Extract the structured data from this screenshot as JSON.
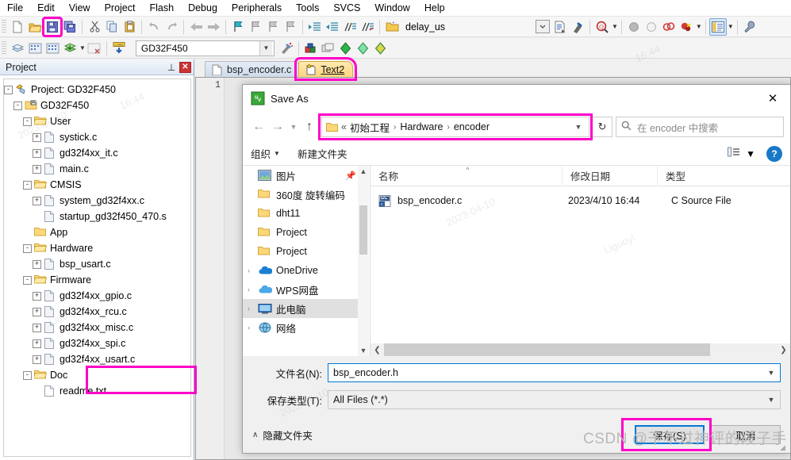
{
  "app": {
    "menu": [
      "File",
      "Edit",
      "View",
      "Project",
      "Flash",
      "Debug",
      "Peripherals",
      "Tools",
      "SVCS",
      "Window",
      "Help"
    ],
    "toolbar1": {
      "icons": [
        "new-file-icon",
        "open-folder-icon",
        "save-icon",
        "save-all-icon",
        "cut-icon",
        "copy-icon",
        "paste-icon",
        "undo-icon",
        "redo-icon",
        "navigate-back-icon",
        "navigate-forward-icon",
        "bookmark-toggle-icon",
        "bookmark-prev-icon",
        "bookmark-next-icon",
        "bookmark-clear-icon",
        "indent-right-icon",
        "indent-left-icon",
        "comment-icon",
        "uncomment-icon"
      ],
      "function_value": "delay_us",
      "right_icons": [
        "combo-dropdown-icon",
        "insert-file-icon",
        "debug-icon",
        "find-in-files-icon",
        "build-stop-icon",
        "build-run-icon",
        "breakpoint-icon",
        "breakpoint-disable-icon",
        "window-layout-icon",
        "configure-icon"
      ]
    },
    "toolbar2": {
      "target_value": "GD32F450",
      "icons": [
        "translate-icon",
        "build-icon",
        "rebuild-icon",
        "batch-build-icon",
        "stop-build-icon",
        "download-icon",
        "target-options-icon",
        "manage-components-icon",
        "pack-installer-icon",
        "configuration-wizard-icon",
        "books-icon"
      ]
    },
    "highlight_color": "#ff00c8"
  },
  "project_panel": {
    "title": "Project",
    "pin_icon": "pin-icon",
    "close_icon": "close-icon",
    "tree": [
      {
        "label": "Project: GD32F450",
        "depth": 0,
        "expander": "-",
        "icon": "project-icon"
      },
      {
        "label": "GD32F450",
        "depth": 1,
        "expander": "-",
        "icon": "target-icon"
      },
      {
        "label": "User",
        "depth": 2,
        "expander": "-",
        "icon": "folder-open-icon"
      },
      {
        "label": "systick.c",
        "depth": 3,
        "expander": "+",
        "icon": "c-file-icon"
      },
      {
        "label": "gd32f4xx_it.c",
        "depth": 3,
        "expander": "+",
        "icon": "c-file-icon"
      },
      {
        "label": "main.c",
        "depth": 3,
        "expander": "+",
        "icon": "c-file-icon"
      },
      {
        "label": "CMSIS",
        "depth": 2,
        "expander": "-",
        "icon": "folder-open-icon"
      },
      {
        "label": "system_gd32f4xx.c",
        "depth": 3,
        "expander": "+",
        "icon": "c-file-icon"
      },
      {
        "label": "startup_gd32f450_470.s",
        "depth": 3,
        "expander": "",
        "icon": "asm-file-icon"
      },
      {
        "label": "App",
        "depth": 2,
        "expander": "",
        "icon": "folder-icon"
      },
      {
        "label": "Hardware",
        "depth": 2,
        "expander": "-",
        "icon": "folder-open-icon"
      },
      {
        "label": "bsp_usart.c",
        "depth": 3,
        "expander": "+",
        "icon": "c-file-icon"
      },
      {
        "label": "Firmware",
        "depth": 2,
        "expander": "-",
        "icon": "folder-open-icon"
      },
      {
        "label": "gd32f4xx_gpio.c",
        "depth": 3,
        "expander": "+",
        "icon": "c-file-icon"
      },
      {
        "label": "gd32f4xx_rcu.c",
        "depth": 3,
        "expander": "+",
        "icon": "c-file-icon"
      },
      {
        "label": "gd32f4xx_misc.c",
        "depth": 3,
        "expander": "+",
        "icon": "c-file-icon"
      },
      {
        "label": "gd32f4xx_spi.c",
        "depth": 3,
        "expander": "+",
        "icon": "c-file-icon"
      },
      {
        "label": "gd32f4xx_usart.c",
        "depth": 3,
        "expander": "+",
        "icon": "c-file-icon"
      },
      {
        "label": "Doc",
        "depth": 2,
        "expander": "-",
        "icon": "folder-open-icon"
      },
      {
        "label": "readme.txt",
        "depth": 3,
        "expander": "",
        "icon": "txt-file-icon"
      }
    ]
  },
  "editor": {
    "tabs": [
      {
        "label": "bsp_encoder.c",
        "active": false
      },
      {
        "label": "Text2",
        "active": true
      }
    ],
    "line_number": "1"
  },
  "dialog": {
    "title": "Save As",
    "title_icon": "keil-vision-icon",
    "close_label": "✕",
    "nav": {
      "back_icon": "arrow-left-icon",
      "forward_icon": "arrow-right-icon",
      "recent_icon": "chevron-down-icon",
      "up_icon": "arrow-up-icon",
      "breadcrumb_prefix": "«",
      "breadcrumbs": [
        "初始工程",
        "Hardware",
        "encoder"
      ],
      "breadcrumb_dropdown_icon": "chevron-down-icon",
      "refresh_icon": "refresh-icon",
      "search_icon": "search-icon",
      "search_placeholder": "在 encoder 中搜索"
    },
    "commandbar": {
      "organize": "组织",
      "new_folder": "新建文件夹",
      "view_icon": "view-layout-icon",
      "help_label": "?"
    },
    "navpane": [
      {
        "label": "图片",
        "icon": "pictures-icon",
        "pinned": true,
        "chevron": "",
        "selected": false
      },
      {
        "label": "360度 旋转编码",
        "icon": "folder-icon",
        "pinned": false,
        "chevron": "",
        "selected": false
      },
      {
        "label": "dht11",
        "icon": "folder-icon",
        "pinned": false,
        "chevron": "",
        "selected": false
      },
      {
        "label": "Project",
        "icon": "folder-icon",
        "pinned": false,
        "chevron": "",
        "selected": false
      },
      {
        "label": "Project",
        "icon": "folder-icon",
        "pinned": false,
        "chevron": "",
        "selected": false
      },
      {
        "label": "OneDrive",
        "icon": "onedrive-icon",
        "pinned": false,
        "chevron": "›",
        "selected": false
      },
      {
        "label": "WPS网盘",
        "icon": "wps-cloud-icon",
        "pinned": false,
        "chevron": "›",
        "selected": false
      },
      {
        "label": "此电脑",
        "icon": "this-pc-icon",
        "pinned": false,
        "chevron": "›",
        "selected": true
      },
      {
        "label": "网络",
        "icon": "network-icon",
        "pinned": false,
        "chevron": "›",
        "selected": false
      }
    ],
    "navpane_scroll": {
      "up_icon": "chevron-up-icon",
      "down_icon": "chevron-down-icon"
    },
    "filelist": {
      "columns": [
        "名称",
        "修改日期",
        "类型"
      ],
      "sort_indicator": "^",
      "rows": [
        {
          "name": "bsp_encoder.c",
          "modified": "2023/4/10 16:44",
          "type": "C Source File",
          "icon": "c-source-file-icon"
        }
      ],
      "hscroll": {
        "left_icon": "chevron-left-icon",
        "right_icon": "chevron-right-icon"
      }
    },
    "form": {
      "filename_label": "文件名(N):",
      "filename_value": "bsp_encoder.h",
      "filetype_label": "保存类型(T):",
      "filetype_value": "All Files (*.*)",
      "dropdown_icon": "chevron-down-icon"
    },
    "footer": {
      "hide_folders_label": "隐藏文件夹",
      "hide_folders_chevron": "∧",
      "save_label": "保存(S)",
      "cancel_label": "取消"
    }
  },
  "watermark": {
    "text": "CSDN @干不过神评的段子手",
    "tilted": [
      "2023-04-10",
      "16:44",
      "Liguoyi",
      "2023-04-10",
      "16:44",
      "Liguoyi",
      "2023-04-10"
    ]
  }
}
